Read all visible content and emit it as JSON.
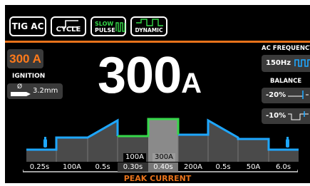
{
  "mode_buttons": {
    "tig_ac": "TIG AC",
    "cycle": "CYCLE",
    "slow_pulse_line1": "SLOW",
    "slow_pulse_line2": "PULSE",
    "dynamic": "DYNAMIC"
  },
  "ignition": {
    "current": "300 A",
    "title": "IGNITION",
    "electrode_symbol": "Ø",
    "electrode_diameter": "3.2mm"
  },
  "main_current": {
    "value": "300",
    "unit": "A"
  },
  "ac_frequency": {
    "title": "AC FREQUENCY",
    "value": "150Hz"
  },
  "balance": {
    "title": "BALANCE",
    "value_1": "-20%",
    "value_2": "-10%"
  },
  "cycle_params": [
    {
      "label": "0.25s"
    },
    {
      "label": "100A"
    },
    {
      "label": "0.5s"
    },
    {
      "label": "0.30s"
    },
    {
      "label": "0.40s"
    },
    {
      "label": "200A"
    },
    {
      "label": "0.5s"
    },
    {
      "label": "50A"
    },
    {
      "label": "6.0s"
    }
  ],
  "pulse_values": {
    "background": "100A",
    "peak": "300A"
  },
  "footer_label": "PEAK CURRENT",
  "colors": {
    "accent_orange": "#e8731b",
    "pulse_green": "#36d84a",
    "curve_blue": "#1ea7ff"
  }
}
